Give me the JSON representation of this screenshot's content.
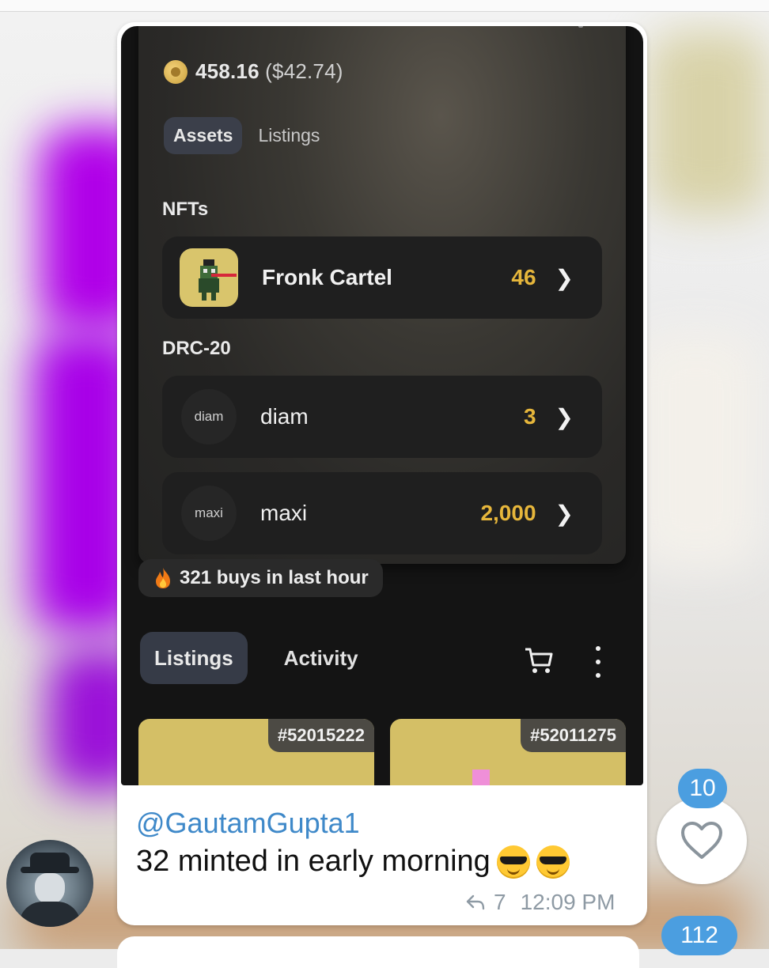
{
  "wallet": {
    "balance": "458.16",
    "balance_usd": "($42.74)",
    "tabs": [
      "Assets",
      "Listings"
    ],
    "nfts_heading": "NFTs",
    "nfts": [
      {
        "name": "Fronk Cartel",
        "count": "46"
      }
    ],
    "drc20_heading": "DRC-20",
    "tokens": [
      {
        "icon_label": "diam",
        "name": "diam",
        "count": "3"
      },
      {
        "icon_label": "maxi",
        "name": "maxi",
        "count": "2,000"
      }
    ]
  },
  "buys_banner": "321 buys in last hour",
  "market_tabs": [
    "Listings",
    "Activity"
  ],
  "listing_cards": [
    {
      "tag": "#52015222"
    },
    {
      "tag": "#52011275"
    }
  ],
  "message": {
    "sender": "@GautamGupta1",
    "text": "32 minted in early morning",
    "forward_count": "7",
    "time": "12:09 PM"
  },
  "reactions": {
    "like_count": "10",
    "next_count": "112"
  },
  "colors": {
    "accent_count": "#e6b63b",
    "link": "#3f89c9",
    "badge": "#4b9ee0"
  }
}
